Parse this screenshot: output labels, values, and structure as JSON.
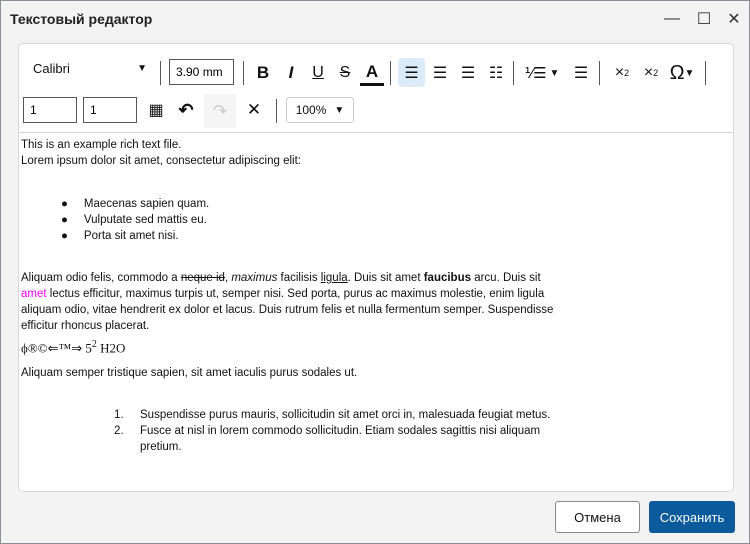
{
  "window": {
    "title": "Текстовый редактор"
  },
  "toolbar": {
    "font": "Calibri",
    "font_size": "3.90 mm",
    "rows": "1",
    "cols": "1",
    "zoom": "100%"
  },
  "document": {
    "line1": "This is an example rich text file.",
    "line2": "Lorem ipsum dolor sit amet, consectetur adipiscing elit:",
    "bullets": [
      "Maecenas sapien quam.",
      "Vulputate sed mattis eu.",
      "Porta sit amet nisi."
    ],
    "p_a": "Aliquam odio felis, commodo a ",
    "p_strike": "neque id",
    "p_b": ", ",
    "p_italic": "maximus",
    "p_c": " facilisis ",
    "p_under": "ligula",
    "p_d": ". Duis sit amet ",
    "p_bold": "faucibus",
    "p_e": " arcu. Duis sit",
    "p_pink": "amet",
    "p_f": " lectus efficitur, maximus turpis ut, semper nisi. Sed porta, purus ac maximus molestie, enim ligula",
    "p_g": "aliquam odio, vitae hendrerit ex dolor et lacus. Duis rutrum felis et nulla fermentum semper. Suspendisse",
    "p_h": "efficitur rhoncus placerat.",
    "symbols": "ϕ®©⇐™⇒ 5",
    "sup": "2",
    "h2o_h": " H",
    "h2o_2": "2",
    "h2o_o": "O",
    "line3": "Aliquam semper tristique sapien, sit amet iaculis purus sodales ut.",
    "numbered": [
      {
        "n": "1.",
        "t": "Suspendisse purus mauris, sollicitudin sit amet orci in, malesuada feugiat metus."
      },
      {
        "n": "2.",
        "t": "Fusce at nisl in lorem commodo sollicitudin. Etiam sodales sagittis nisi aliquam",
        "t2": "pretium."
      }
    ]
  },
  "footer": {
    "cancel": "Отмена",
    "save": "Сохранить"
  },
  "colors": {
    "accent": "#0a5a9c",
    "pink": "#ff00ff"
  }
}
